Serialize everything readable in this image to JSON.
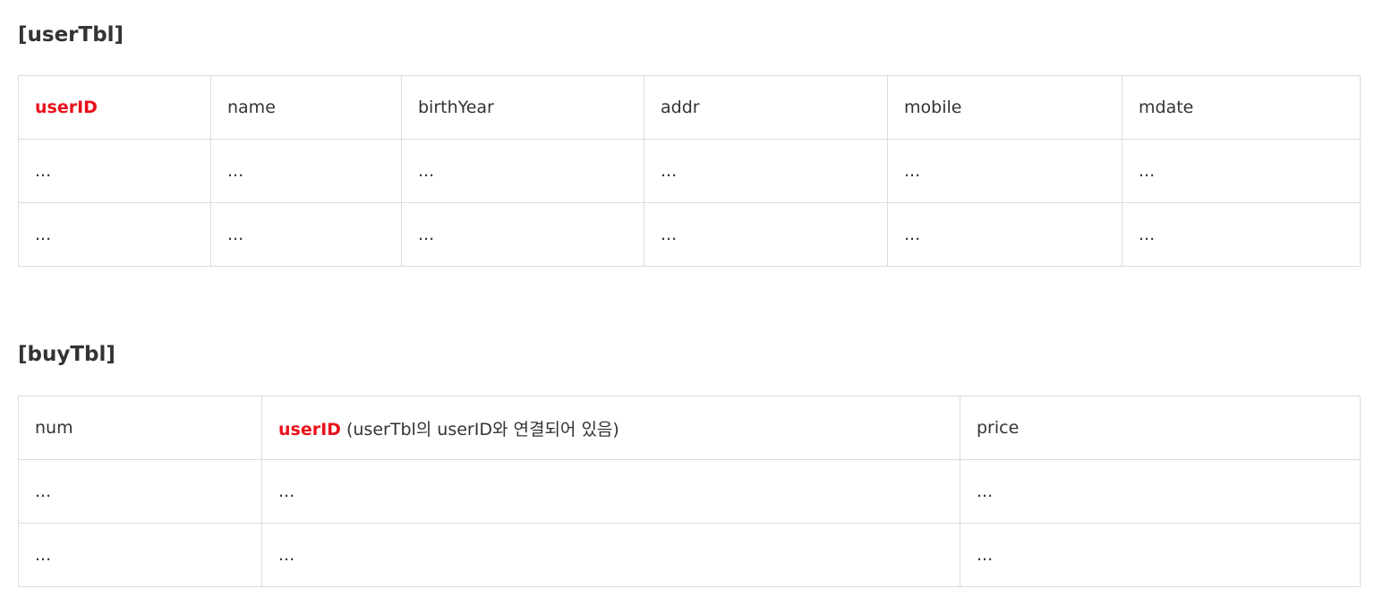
{
  "user_table": {
    "title": "[userTbl]",
    "headers": [
      "userID",
      "name",
      "birthYear",
      "addr",
      "mobile",
      "mdate"
    ],
    "rows": [
      [
        "...",
        "...",
        "...",
        "...",
        "...",
        "..."
      ],
      [
        "...",
        "...",
        "...",
        "...",
        "...",
        "..."
      ]
    ]
  },
  "buy_table": {
    "title": "[buyTbl]",
    "headers": [
      "num",
      "userID",
      "price"
    ],
    "userid_note": " (userTbl의 userID와 연결되어 있음)",
    "rows": [
      [
        "...",
        "...",
        "..."
      ],
      [
        "...",
        "...",
        "..."
      ]
    ]
  },
  "colors": {
    "key_column": "#e8111c",
    "text": "#333333",
    "border": "#dcdcdc"
  }
}
